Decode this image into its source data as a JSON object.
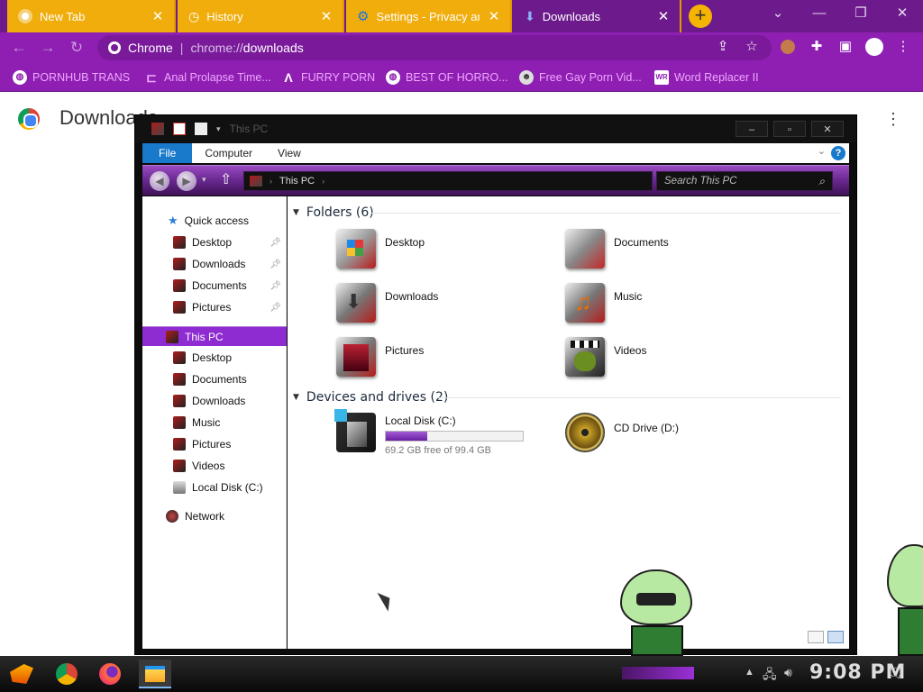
{
  "browser": {
    "tabs": [
      {
        "label": "New Tab",
        "icon": "chrome-icon"
      },
      {
        "label": "History",
        "icon": "history-icon"
      },
      {
        "label": "Settings - Privacy and",
        "icon": "gear-icon"
      },
      {
        "label": "Downloads",
        "icon": "download-icon",
        "active": true
      }
    ],
    "new_tab_symbol": "+",
    "omnibox": {
      "site_label": "Chrome",
      "url_scheme": "chrome://",
      "url_host": "downloads"
    },
    "bookmarks": [
      {
        "label": "PORNHUB TRANS",
        "icon": "globe-icon"
      },
      {
        "label": "Anal Prolapse Time...",
        "icon": "bracket-icon"
      },
      {
        "label": "FURRY PORN",
        "icon": "lambda-icon"
      },
      {
        "label": "BEST OF HORRO...",
        "icon": "globe-icon"
      },
      {
        "label": "Free Gay Porn Vid...",
        "icon": "mask-icon"
      },
      {
        "label": "Word Replacer II",
        "icon": "wr-icon"
      }
    ],
    "colors": {
      "tabstrip": "#6d1b8c",
      "toolbar": "#8e1fb2",
      "inactive_tab": "#f0ad0b"
    }
  },
  "page": {
    "title": "Downloads"
  },
  "explorer": {
    "window_title": "This PC",
    "window_buttons": [
      "–",
      "▫",
      "✕"
    ],
    "ribbon_tabs": [
      "File",
      "Computer",
      "View"
    ],
    "help_symbol": "?",
    "address": {
      "location": "This PC"
    },
    "search_placeholder": "Search This PC",
    "nav_pane": {
      "quick_access": "Quick access",
      "quick_items": [
        "Desktop",
        "Downloads",
        "Documents",
        "Pictures"
      ],
      "this_pc": "This PC",
      "pc_items": [
        "Desktop",
        "Documents",
        "Downloads",
        "Music",
        "Pictures",
        "Videos",
        "Local Disk (C:)"
      ],
      "network": "Network"
    },
    "folders_header": "Folders (6)",
    "folders": [
      {
        "name": "Desktop",
        "icon": "desktop-folder-icon"
      },
      {
        "name": "Documents",
        "icon": "documents-folder-icon"
      },
      {
        "name": "Downloads",
        "icon": "downloads-folder-icon"
      },
      {
        "name": "Music",
        "icon": "music-folder-icon"
      },
      {
        "name": "Pictures",
        "icon": "pictures-folder-icon"
      },
      {
        "name": "Videos",
        "icon": "videos-folder-icon"
      }
    ],
    "devices_header": "Devices and drives (2)",
    "drives": [
      {
        "name": "Local Disk (C:)",
        "free_text": "69.2 GB free of 99.4 GB",
        "used_fraction": 0.3
      },
      {
        "name": "CD Drive (D:)"
      }
    ]
  },
  "taskbar": {
    "clock": "9:08 PM",
    "apps": [
      "start-icon",
      "chrome-icon",
      "firefox-icon",
      "file-explorer-icon"
    ]
  }
}
